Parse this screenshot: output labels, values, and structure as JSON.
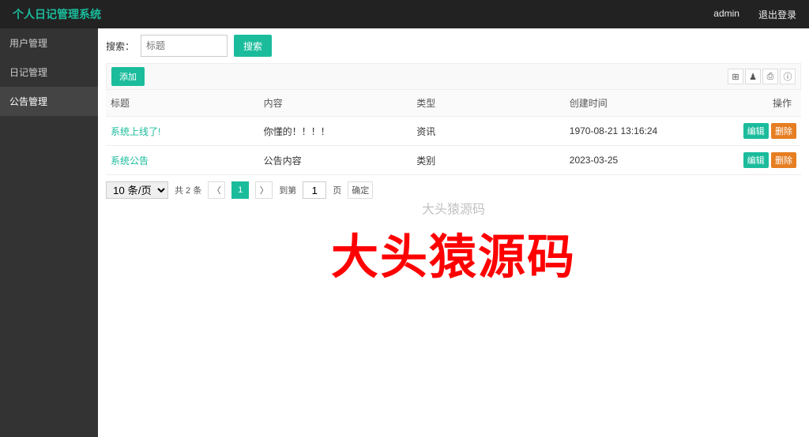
{
  "header": {
    "brand": "个人日记管理系统",
    "user": "admin",
    "logout": "退出登录"
  },
  "sidebar": {
    "items": [
      {
        "label": "用户管理"
      },
      {
        "label": "日记管理"
      },
      {
        "label": "公告管理"
      }
    ]
  },
  "search": {
    "label": "搜索：",
    "placeholder": "标题",
    "btn": "搜索"
  },
  "add_btn": "添加",
  "icons": {
    "grid": "⊞",
    "user": "♟",
    "print": "⎙",
    "info": "ⓘ"
  },
  "table": {
    "cols": {
      "title": "标题",
      "content": "内容",
      "type": "类型",
      "created": "创建时间",
      "ops": "操作"
    },
    "rows": [
      {
        "title": "系统上线了!",
        "content": "你懂的！！！！",
        "type": "资讯",
        "created": "1970-08-21 13:16:24"
      },
      {
        "title": "系统公告",
        "content": "公告内容",
        "type": "类别",
        "created": "2023-03-25"
      }
    ],
    "ops": {
      "edit": "编辑",
      "del": "删除"
    }
  },
  "pager": {
    "size": "10 条/页",
    "total": "共 2 条",
    "prev": "〈",
    "next": "〉",
    "page": "1",
    "goto_pre": "到第",
    "goto_input": "1",
    "goto_suf": "页",
    "confirm": "确定"
  },
  "watermark": {
    "big": "大头猿源码",
    "shadow": "大头猿源码"
  }
}
